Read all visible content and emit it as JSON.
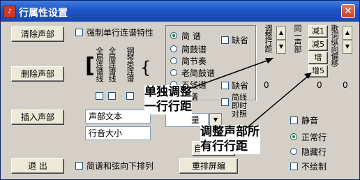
{
  "window": {
    "title": "行属性设置",
    "close": "✕"
  },
  "buttons": {
    "clear_voice": "清除声部",
    "delete_voice": "删除声部",
    "insert_voice": "插入声部",
    "exit": "退 出",
    "reset": "重排",
    "reset_tail": "屏编",
    "auto": "自"
  },
  "checks": {
    "force_single_line": {
      "label": "强制单行连谱特性",
      "checked": false
    },
    "simplified_down": {
      "label": "简谱和弦向下排列",
      "checked": false
    },
    "missing1": {
      "label": "缺省",
      "checked": false
    },
    "missing2": {
      "label": "缺省",
      "checked": false
    },
    "silent": {
      "label": "静音",
      "checked": false
    },
    "no_draw": {
      "label": "不绘制",
      "checked": false
    }
  },
  "notation_labels": [
    "全局连谱线",
    "全局连谱线",
    "钢琴类连谱"
  ],
  "score_types": [
    {
      "label": "简  谱",
      "selected": true
    },
    {
      "label": "简鼓谱",
      "selected": false
    },
    {
      "label": "简节奏",
      "selected": false
    },
    {
      "label": "老简鼓谱",
      "selected": false
    },
    {
      "label": "五线谱",
      "selected": false
    },
    {
      "label": "鼓谱",
      "selected": false
    }
  ],
  "simplified_line_label": "简线即时对照",
  "fields": {
    "voice_text": "声部文本",
    "line_size": "行音大小",
    "volume_tail": "量"
  },
  "vertical_labels": {
    "adjust_line_distance": "调整行距",
    "same_voice_part": "同一声部",
    "lyric_vertical_offset": "歌词纵向偏移"
  },
  "counters": {
    "left": "0",
    "mid": "0",
    "right": "0"
  },
  "small_buttons": [
    "减1",
    "减5",
    "增",
    "增5"
  ],
  "display_modes": [
    {
      "label": "正常行",
      "selected": true
    },
    {
      "label": "隐藏行",
      "selected": false
    }
  ],
  "annotations": {
    "single_line": "单独调整一行行距",
    "all_lines": "调整声部所有行行距"
  }
}
